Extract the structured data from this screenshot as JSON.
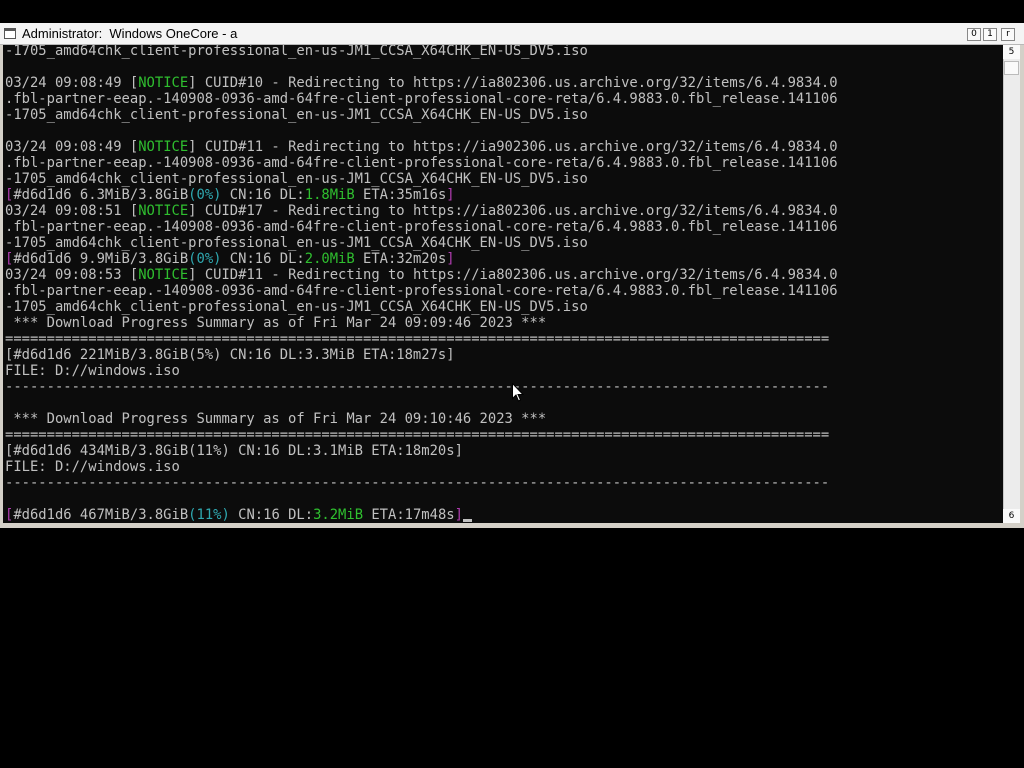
{
  "window": {
    "title": "Administrator:  Windows OneCore - a",
    "buttons": {
      "minimize_glyph": "0",
      "maximize_glyph": "1",
      "close_glyph": "r"
    },
    "scrollbar": {
      "up_glyph": "5",
      "down_glyph": "6"
    }
  },
  "console": {
    "lines": [
      [
        {
          "t": "-1705_amd64chk_client-professional_en-us-JM1_CCSA_X64CHK_EN-US_DV5.iso"
        }
      ],
      [
        {
          "t": ""
        }
      ],
      [
        {
          "t": "03/24 09:08:49 ["
        },
        {
          "t": "NOTICE",
          "c": "notice"
        },
        {
          "t": "] CUID#10 - Redirecting to https://ia802306.us.archive.org/32/items/6.4.9834.0"
        }
      ],
      [
        {
          "t": ".fbl-partner-eeap.-140908-0936-amd-64fre-client-professional-core-reta/6.4.9883.0.fbl_release.141106"
        }
      ],
      [
        {
          "t": "-1705_amd64chk_client-professional_en-us-JM1_CCSA_X64CHK_EN-US_DV5.iso"
        }
      ],
      [
        {
          "t": ""
        }
      ],
      [
        {
          "t": "03/24 09:08:49 ["
        },
        {
          "t": "NOTICE",
          "c": "notice"
        },
        {
          "t": "] CUID#11 - Redirecting to https://ia902306.us.archive.org/32/items/6.4.9834.0"
        }
      ],
      [
        {
          "t": ".fbl-partner-eeap.-140908-0936-amd-64fre-client-professional-core-reta/6.4.9883.0.fbl_release.141106"
        }
      ],
      [
        {
          "t": "-1705_amd64chk_client-professional_en-us-JM1_CCSA_X64CHK_EN-US_DV5.iso"
        }
      ],
      [
        {
          "t": "[",
          "c": "mag"
        },
        {
          "t": "#d6d1d6 6.3MiB/3.8GiB"
        },
        {
          "t": "(0%)",
          "c": "cyan"
        },
        {
          "t": " CN:16 DL:"
        },
        {
          "t": "1.8MiB",
          "c": "grn"
        },
        {
          "t": " ETA:35m16s"
        },
        {
          "t": "]",
          "c": "mag"
        }
      ],
      [
        {
          "t": "03/24 09:08:51 ["
        },
        {
          "t": "NOTICE",
          "c": "notice"
        },
        {
          "t": "] CUID#17 - Redirecting to https://ia802306.us.archive.org/32/items/6.4.9834.0"
        }
      ],
      [
        {
          "t": ".fbl-partner-eeap.-140908-0936-amd-64fre-client-professional-core-reta/6.4.9883.0.fbl_release.141106"
        }
      ],
      [
        {
          "t": "-1705_amd64chk_client-professional_en-us-JM1_CCSA_X64CHK_EN-US_DV5.iso"
        }
      ],
      [
        {
          "t": "[",
          "c": "mag"
        },
        {
          "t": "#d6d1d6 9.9MiB/3.8GiB"
        },
        {
          "t": "(0%)",
          "c": "cyan"
        },
        {
          "t": " CN:16 DL:"
        },
        {
          "t": "2.0MiB",
          "c": "grn"
        },
        {
          "t": " ETA:32m20s"
        },
        {
          "t": "]",
          "c": "mag"
        }
      ],
      [
        {
          "t": "03/24 09:08:53 ["
        },
        {
          "t": "NOTICE",
          "c": "notice"
        },
        {
          "t": "] CUID#11 - Redirecting to https://ia802306.us.archive.org/32/items/6.4.9834.0"
        }
      ],
      [
        {
          "t": ".fbl-partner-eeap.-140908-0936-amd-64fre-client-professional-core-reta/6.4.9883.0.fbl_release.141106"
        }
      ],
      [
        {
          "t": "-1705_amd64chk_client-professional_en-us-JM1_CCSA_X64CHK_EN-US_DV5.iso"
        }
      ],
      [
        {
          "t": " *** Download Progress Summary as of Fri Mar 24 09:09:46 2023 ***"
        }
      ],
      [
        {
          "t": "==================================================================================================="
        }
      ],
      [
        {
          "t": "[#d6d1d6 221MiB/3.8GiB(5%) CN:16 DL:3.3MiB ETA:18m27s]"
        }
      ],
      [
        {
          "t": "FILE: D://windows.iso"
        }
      ],
      [
        {
          "t": "---------------------------------------------------------------------------------------------------"
        }
      ],
      [
        {
          "t": ""
        }
      ],
      [
        {
          "t": " *** Download Progress Summary as of Fri Mar 24 09:10:46 2023 ***"
        }
      ],
      [
        {
          "t": "==================================================================================================="
        }
      ],
      [
        {
          "t": "[#d6d1d6 434MiB/3.8GiB(11%) CN:16 DL:3.1MiB ETA:18m20s]"
        }
      ],
      [
        {
          "t": "FILE: D://windows.iso"
        }
      ],
      [
        {
          "t": "---------------------------------------------------------------------------------------------------"
        }
      ],
      [
        {
          "t": ""
        }
      ],
      [
        {
          "t": "[",
          "c": "mag"
        },
        {
          "t": "#d6d1d6 467MiB/3.8GiB"
        },
        {
          "t": "(11%)",
          "c": "cyan"
        },
        {
          "t": " CN:16 DL:"
        },
        {
          "t": "3.2MiB",
          "c": "grn"
        },
        {
          "t": " ETA:17m48s"
        },
        {
          "t": "]",
          "c": "mag"
        },
        {
          "cursor": true
        }
      ]
    ]
  },
  "colors": {
    "console_bg": "#0c0c0c",
    "text": "#c0c0c0",
    "notice": "#2fbf2f",
    "bracket": "#b03cb0",
    "percent": "#2fa8b0",
    "speed": "#2fbf2f"
  }
}
